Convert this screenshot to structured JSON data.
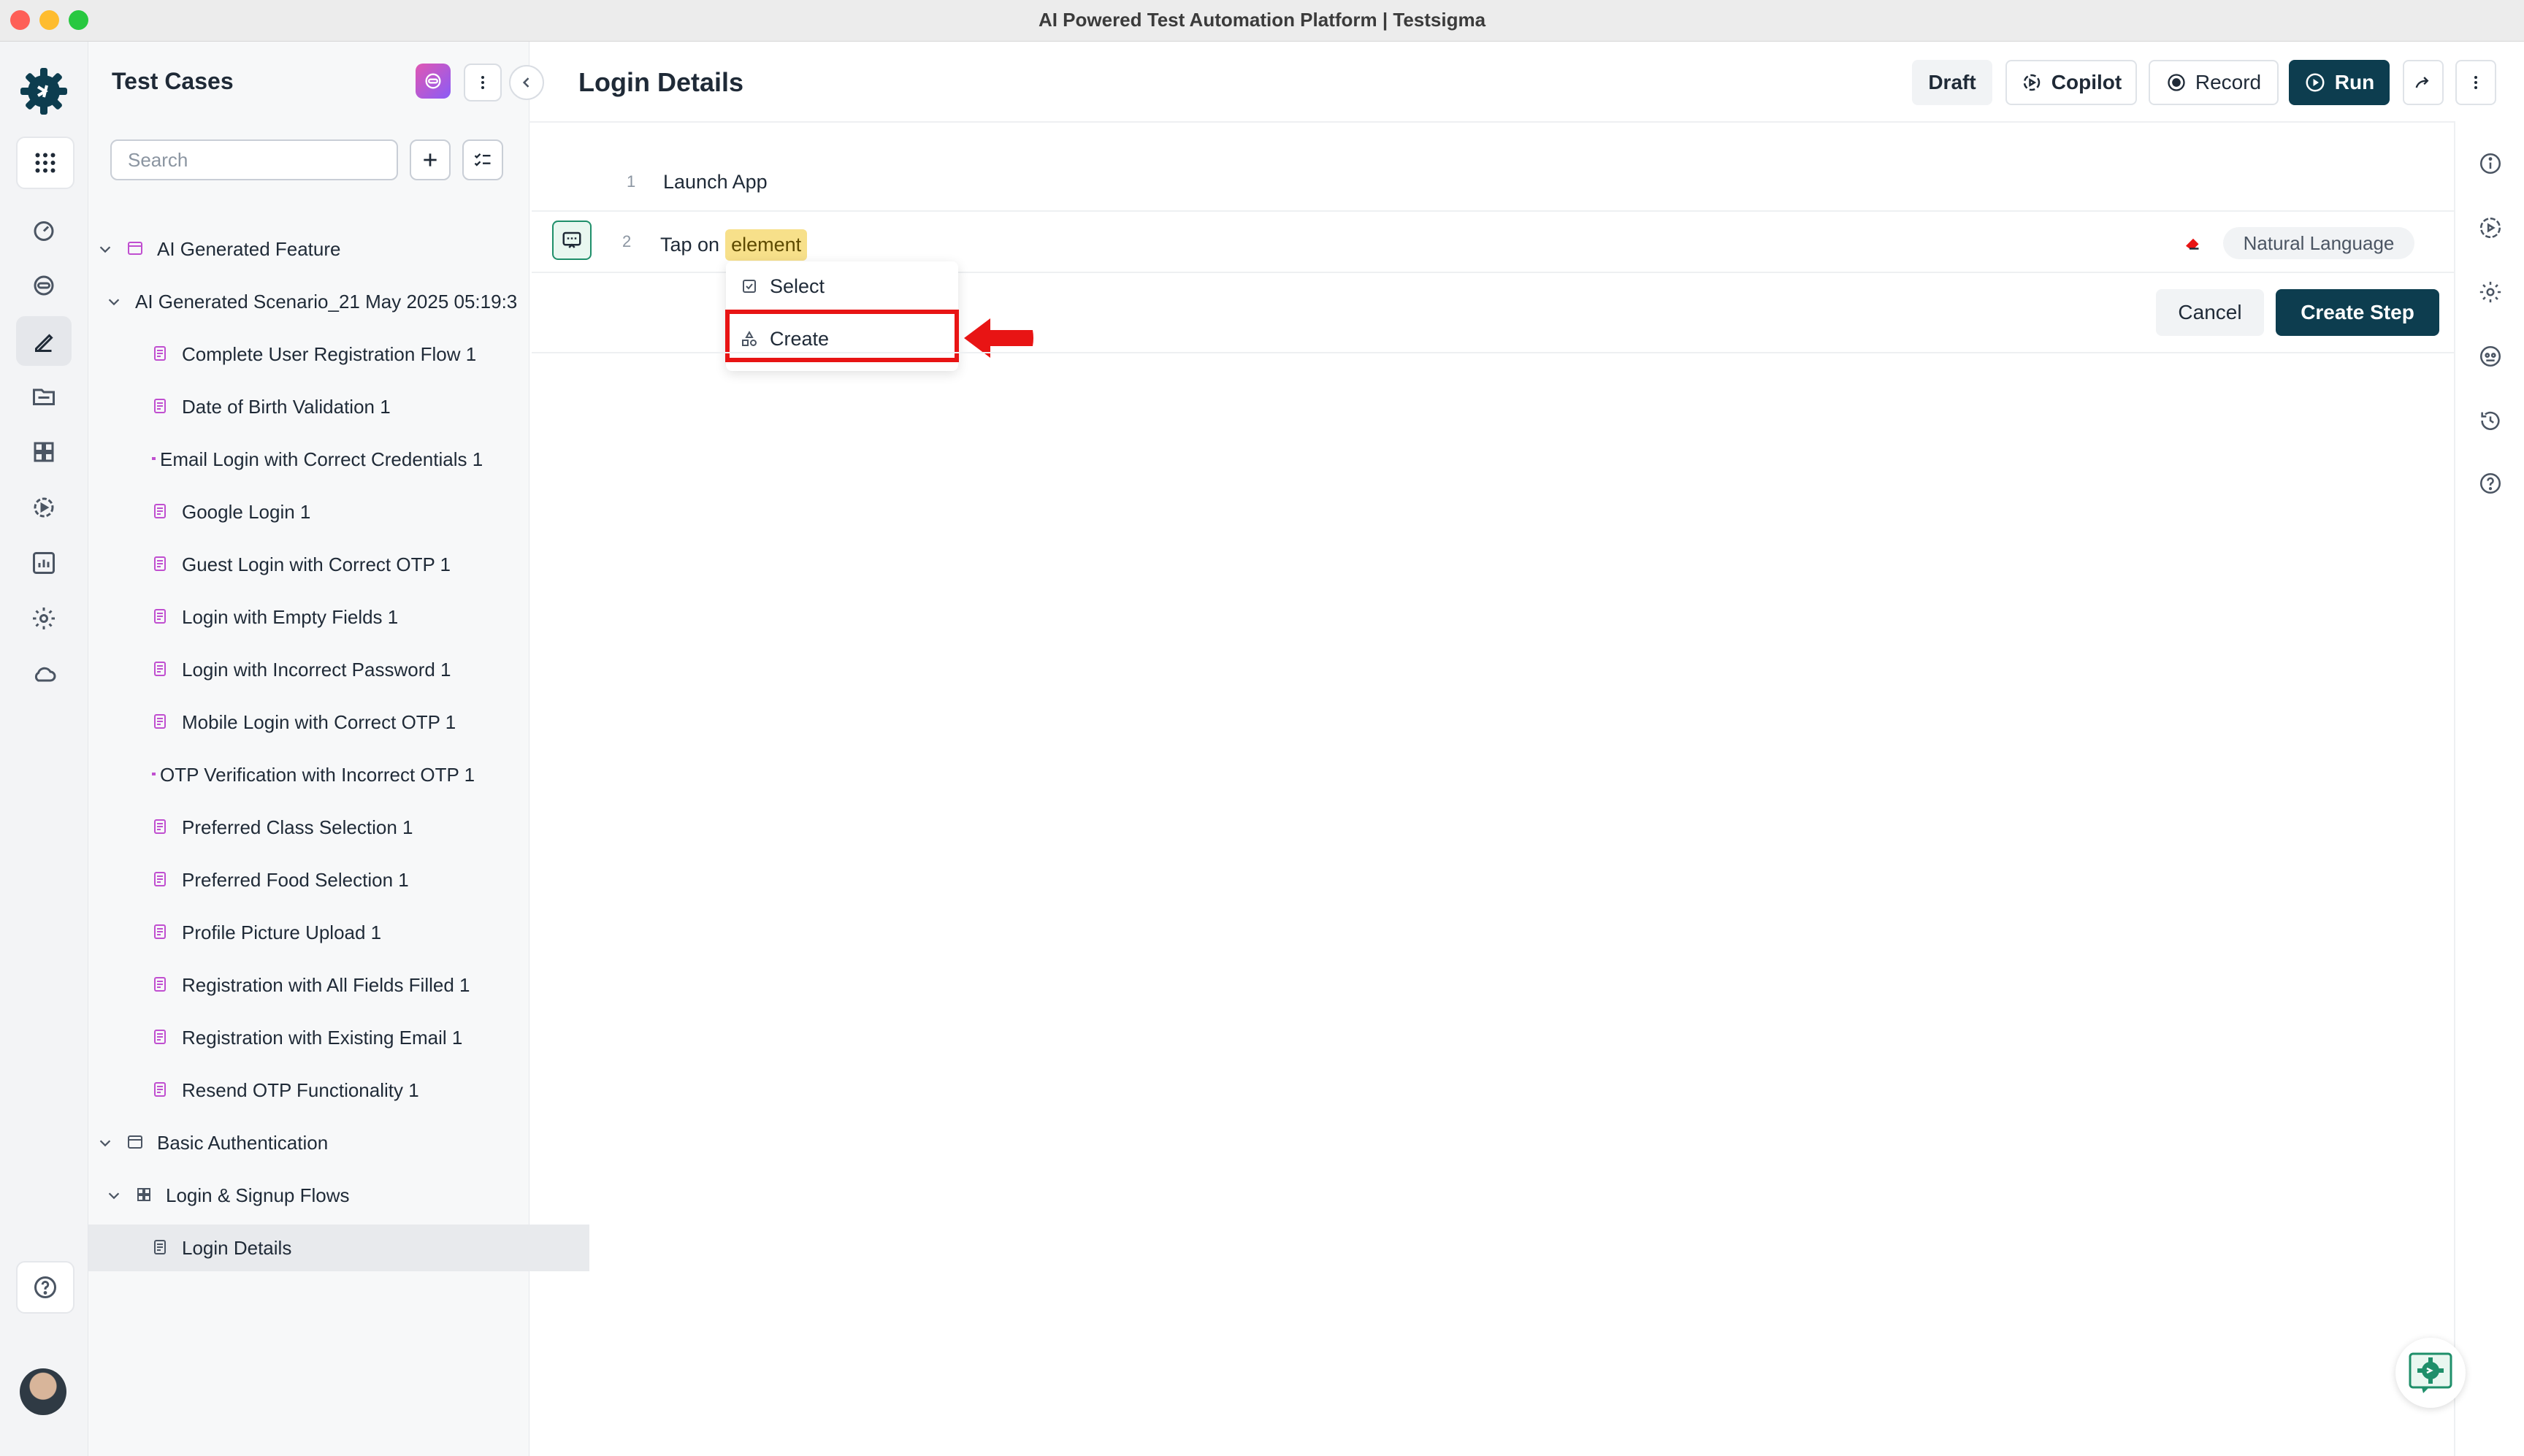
{
  "window": {
    "title": "AI Powered Test Automation Platform | Testsigma"
  },
  "sidebar": {
    "title": "Test Cases",
    "search_placeholder": "Search",
    "tree": [
      {
        "label": "AI Generated Feature",
        "level": "feature",
        "expanded": true
      },
      {
        "label": "AI Generated Scenario_21 May 2025 05:19:3",
        "level": "scenario",
        "expanded": true
      },
      {
        "label": "Complete User Registration Flow 1",
        "level": "case"
      },
      {
        "label": "Date of Birth Validation 1",
        "level": "case"
      },
      {
        "label": "Email Login with Correct Credentials 1",
        "level": "case"
      },
      {
        "label": "Google Login 1",
        "level": "case"
      },
      {
        "label": "Guest Login with Correct OTP 1",
        "level": "case"
      },
      {
        "label": "Login with Empty Fields 1",
        "level": "case"
      },
      {
        "label": "Login with Incorrect Password 1",
        "level": "case"
      },
      {
        "label": "Mobile Login with Correct OTP 1",
        "level": "case"
      },
      {
        "label": "OTP Verification with Incorrect OTP 1",
        "level": "case"
      },
      {
        "label": "Preferred Class Selection 1",
        "level": "case"
      },
      {
        "label": "Preferred Food Selection 1",
        "level": "case"
      },
      {
        "label": "Profile Picture Upload 1",
        "level": "case"
      },
      {
        "label": "Registration with All Fields Filled 1",
        "level": "case"
      },
      {
        "label": "Registration with Existing Email 1",
        "level": "case"
      },
      {
        "label": "Resend OTP Functionality 1",
        "level": "case"
      },
      {
        "label": "Basic Authentication",
        "level": "feature",
        "expanded": true
      },
      {
        "label": "Login & Signup Flows",
        "level": "scenario",
        "expanded": true
      },
      {
        "label": "Login Details",
        "level": "case",
        "selected": true
      }
    ]
  },
  "header": {
    "title": "Login Details",
    "draft": "Draft",
    "copilot": "Copilot",
    "record": "Record",
    "run": "Run"
  },
  "steps": [
    {
      "num": "1",
      "text": "Launch App"
    },
    {
      "num": "2",
      "prefix": "Tap on",
      "chip": "element",
      "mode": "Natural Language"
    }
  ],
  "dropdown": {
    "select": "Select",
    "create": "Create"
  },
  "actions": {
    "cancel": "Cancel",
    "create_step": "Create Step"
  },
  "colors": {
    "brand": "#0d3d4f",
    "accent": "#1f8f6a",
    "highlight": "#e81414",
    "chip": "#f7e08a"
  }
}
